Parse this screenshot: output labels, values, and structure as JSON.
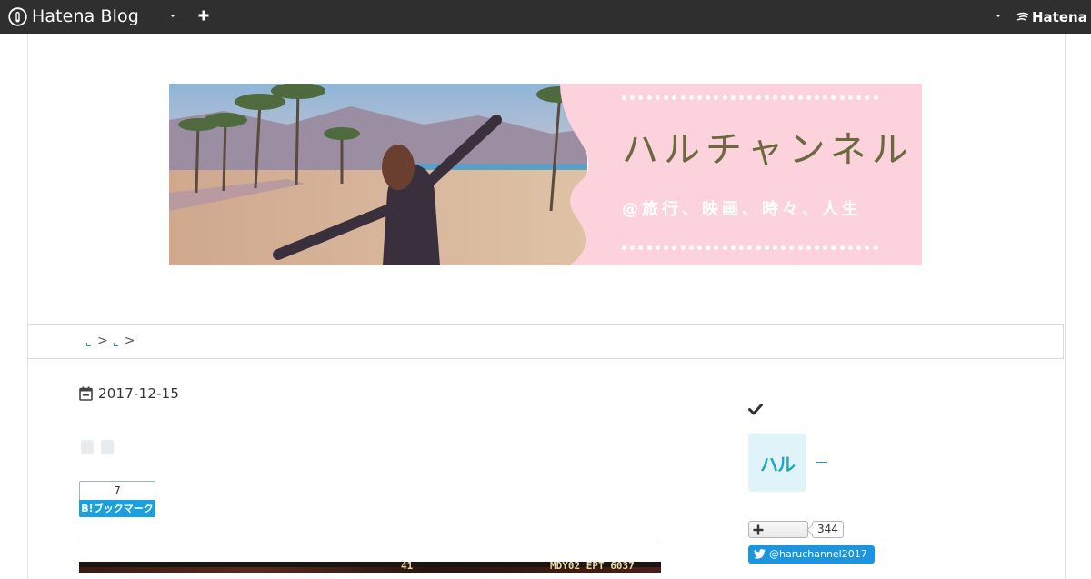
{
  "topbar": {
    "logo_text": "Hatena Blog",
    "hatena_text": "Hatena",
    "icons": [
      "hatena-blog-logo-icon",
      "chevron-down-icon",
      "plus-icon",
      "chevron-down-icon",
      "hatena-logo-icon"
    ]
  },
  "banner": {
    "title": "ハルチャンネル",
    "subtitle": "@旅行、映画、時々、人生",
    "colors": {
      "pink": "#fcd3dc",
      "title": "#6b6a3f"
    }
  },
  "breadcrumb": {
    "separators": [
      ">",
      ">"
    ]
  },
  "article": {
    "date": "2017-12-15",
    "bookmark": {
      "count": "7",
      "label": "B!ブックマーク"
    },
    "image_hud": {
      "left": "41",
      "right": "MDY02  EPT  6037"
    }
  },
  "sidebar": {
    "check_icon": "check-icon",
    "profile_icon_text": "ハル",
    "follow": {
      "count": "344"
    },
    "twitter": {
      "handle": "@haruchannel2017"
    }
  }
}
